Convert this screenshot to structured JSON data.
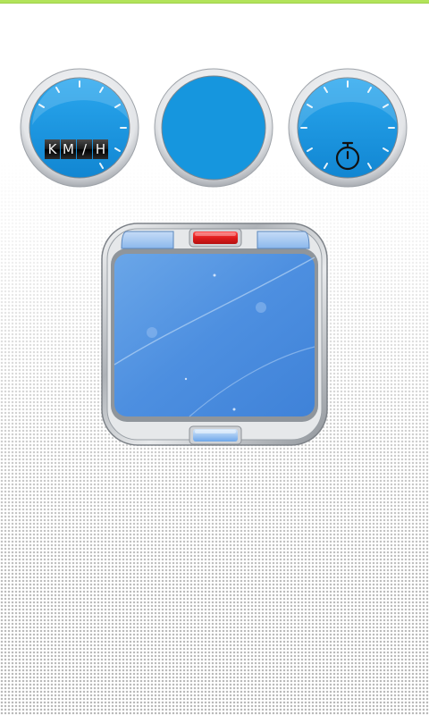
{
  "speedometer": {
    "unit_letters": [
      "K",
      "M",
      "/",
      "H"
    ],
    "icon": "speedometer-dial-icon"
  },
  "center_dial": {
    "icon": "blank-dial-icon"
  },
  "timer": {
    "icon": "stopwatch-icon"
  },
  "display": {
    "top_left_button_icon": "blue-tab-button",
    "top_center_button_icon": "red-indicator-button",
    "top_right_button_icon": "blue-tab-button",
    "bottom_button_icon": "blue-pill-button"
  },
  "colors": {
    "accent_green": "#b2e35a",
    "dial_blue": "#1696de",
    "screen_blue": "#5c9be3",
    "record_red": "#e01c1c",
    "chrome": "#c9ccd0"
  }
}
